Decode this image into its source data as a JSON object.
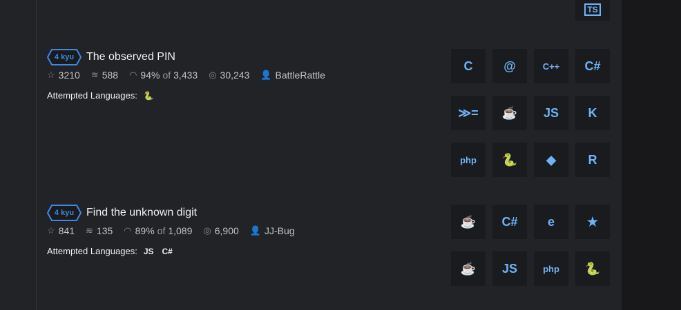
{
  "katas": [
    {
      "rank": "4 kyu",
      "title": "The observed PIN",
      "stars": "3210",
      "collections": "588",
      "satisfaction": "94%",
      "of_label": "of",
      "votes": "3,433",
      "completed": "30,243",
      "author": "BattleRattle",
      "attempted_label": "Attempted Languages:",
      "attempted": [
        "python"
      ],
      "languages": [
        "c",
        "clojure",
        "cpp",
        "csharp",
        "haskell",
        "java",
        "javascript",
        "kotlin",
        "php",
        "python",
        "ruby",
        "rust"
      ]
    },
    {
      "rank": "4 kyu",
      "title": "Find the unknown digit",
      "stars": "841",
      "collections": "135",
      "satisfaction": "89%",
      "of_label": "of",
      "votes": "1,089",
      "completed": "6,900",
      "author": "JJ-Bug",
      "attempted_label": "Attempted Languages:",
      "attempted": [
        "javascript",
        "csharp"
      ],
      "languages": [
        "coffeescript",
        "csharp",
        "elixir",
        "groovy",
        "java",
        "javascript",
        "php",
        "python"
      ]
    }
  ],
  "top_language": "typescript",
  "icon_glyphs": {
    "c": "C",
    "clojure": "@",
    "cpp": "C++",
    "csharp": "C#",
    "haskell": "≫=",
    "java": "☕",
    "javascript": "JS",
    "kotlin": "K",
    "php": "php",
    "python": "🐍",
    "ruby": "◆",
    "rust": "R",
    "coffeescript": "☕",
    "elixir": "e",
    "groovy": "★",
    "typescript": "TS"
  },
  "accent": "#3c8ae4",
  "icon_color": "#6fb3f5"
}
